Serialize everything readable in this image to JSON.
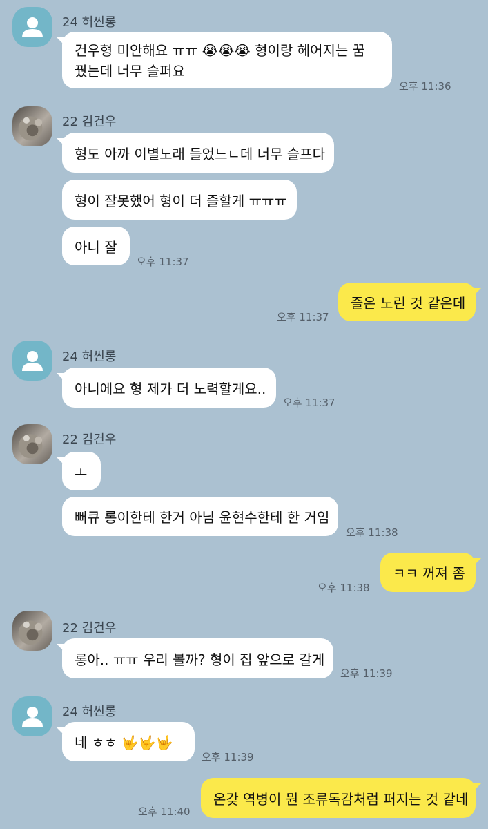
{
  "messages": [
    {
      "sender": "24 허씬롱",
      "text": "건우형 미안해요 ㅠㅠ 😭😭😭 형이랑 헤어지는 꿈 꿨는데 너무 슬퍼요",
      "time": "오후 11:36"
    },
    {
      "sender": "22 김건우",
      "text": "형도 아까 이별노래 들었느ㄴ데 너무 슬프다"
    },
    {
      "text": "형이 잘못했어 형이 더 즐할게 ㅠㅠㅠ"
    },
    {
      "text": "아니 잘",
      "time": "오후 11:37"
    },
    {
      "mine": true,
      "text": "즐은 노린 것 같은데",
      "time": "오후 11:37"
    },
    {
      "sender": "24 허씬롱",
      "text": "아니에요 형 제가 더 노력할게요..",
      "time": "오후 11:37"
    },
    {
      "sender": "22 김건우",
      "text": "ㅗ"
    },
    {
      "text": "뻐큐 롱이한테 한거 아님 윤현수한테 한 거임",
      "time": "오후 11:38"
    },
    {
      "mine": true,
      "text": "ㅋㅋ 꺼져 좀",
      "time": "오후 11:38"
    },
    {
      "sender": "22 김건우",
      "text": "롱아.. ㅠㅠ 우리 볼까? 형이 집 앞으로 갈게",
      "time": "오후 11:39"
    },
    {
      "sender": "24 허씬롱",
      "text": "네 ㅎㅎ 🤟🤟🤟",
      "time": "오후 11:39"
    },
    {
      "mine": true,
      "text": "온갖 역병이 뭔 조류독감처럼 퍼지는 것 같네",
      "time": "오후 11:40"
    }
  ]
}
